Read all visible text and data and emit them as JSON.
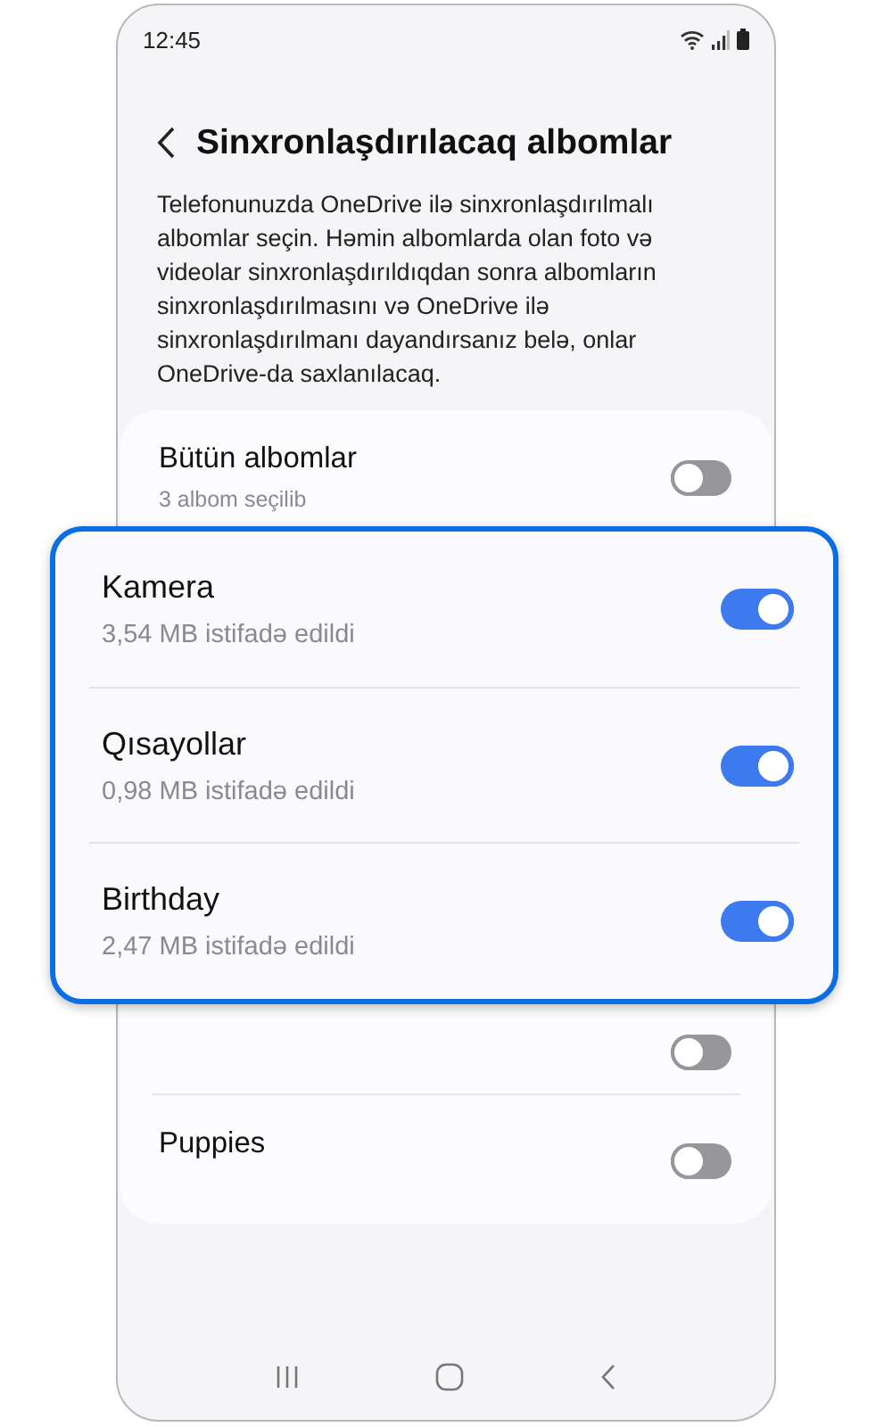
{
  "status_bar": {
    "time": "12:45"
  },
  "header": {
    "title": "Sinxronlaşdırılacaq albomlar"
  },
  "description": "Telefonunuzda OneDrive ilə sinxronlaşdırılmalı albomlar seçin. Həmin albomlarda olan foto və videolar sinxronlaşdırıldıqdan sonra albomların sinxronlaşdırılmasını və OneDrive ilə sinxronlaşdırılmanı dayandırsanız belə, onlar OneDrive-da saxlanılacaq.",
  "all_albums": {
    "title": "Bütün albomlar",
    "subtitle": "3 albom seçilib",
    "on": false
  },
  "albums": [
    {
      "on": false
    },
    {
      "title": "Puppies",
      "on": false
    }
  ],
  "highlight": {
    "albums": [
      {
        "title": "Kamera",
        "subtitle": "3,54 MB istifadə edildi",
        "on": true
      },
      {
        "title": "Qısayollar",
        "subtitle": "0,98 MB istifadə edildi",
        "on": true
      },
      {
        "title": "Birthday",
        "subtitle": "2,47 MB istifadə edildi",
        "on": true
      }
    ]
  }
}
